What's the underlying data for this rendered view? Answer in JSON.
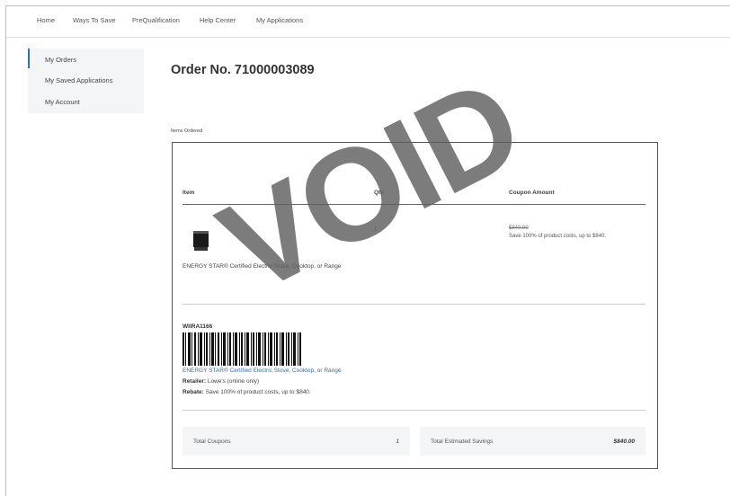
{
  "nav": {
    "items": [
      "Home",
      "Ways To Save",
      "PreQualification",
      "Help Center",
      "My Applications"
    ]
  },
  "sidebar": {
    "items": [
      "My Orders",
      "My Saved Applications",
      "My Account"
    ]
  },
  "order": {
    "title": "Order No. 71000003089",
    "items_ordered_label": "Items Ordered"
  },
  "table": {
    "headers": [
      "Item",
      "Qty",
      "Coupon Amount"
    ],
    "row": {
      "item_name": "ENERGY STAR® Certified Electric Stove, Cooktop, or Range",
      "qty": "1",
      "original_price": "$840.00",
      "coupon_desc": "Save 100% of product costs, up to $840."
    }
  },
  "coupon": {
    "code": "WIIRA1166",
    "product_link": "ENERGY STAR® Certified Electric Stove, Cooktop, or Range",
    "retailer_label": "Retailer:",
    "retailer_value": "Lowe's (online only)",
    "rebate_label": "Rebate:",
    "rebate_value": "Save 100% of product costs, up to $840."
  },
  "totals": {
    "coupons_label": "Total Coupons",
    "coupons_value": "1",
    "savings_label": "Total Estimated Savings",
    "savings_value": "$840.00"
  },
  "watermark": "VOID",
  "colors": {
    "link": "#2f6fb3",
    "active_indicator": "#2f6fb3",
    "panel_bg": "#f4f5f7",
    "watermark": "#5f5f5f"
  }
}
